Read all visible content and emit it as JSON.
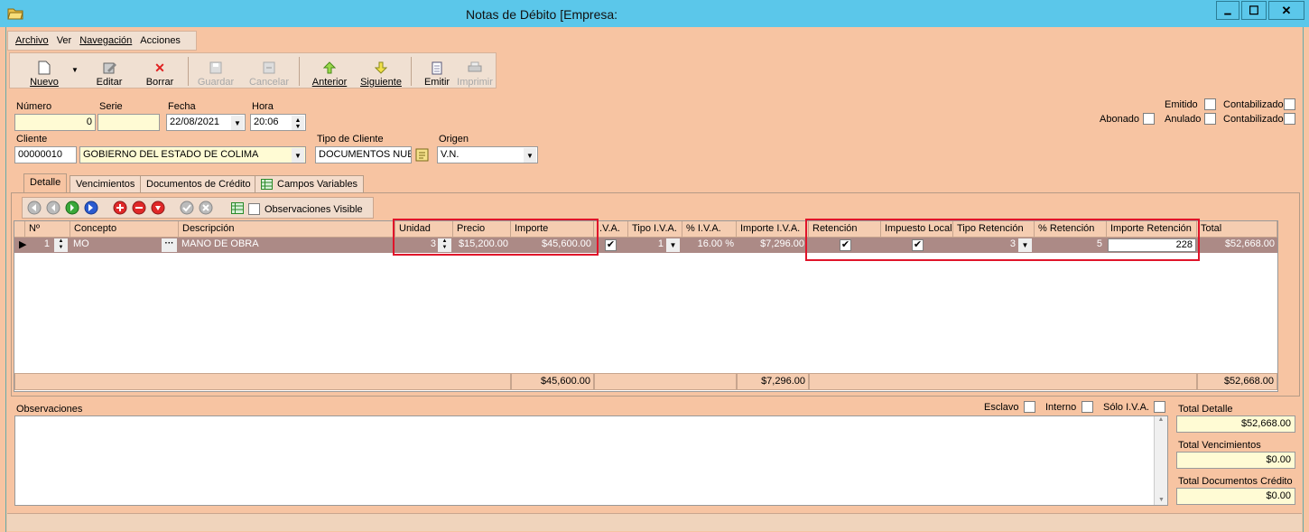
{
  "window": {
    "title": "Notas de Débito [Empresa:",
    "minimize": "▁",
    "maximize": "☐",
    "close": "✕"
  },
  "menu": [
    "Archivo",
    "Ver",
    "Navegación",
    "Acciones"
  ],
  "toolbar": {
    "nuevo": "Nuevo",
    "editar": "Editar",
    "borrar": "Borrar",
    "guardar": "Guardar",
    "cancelar": "Cancelar",
    "anterior": "Anterior",
    "siguiente": "Siguiente",
    "emitir": "Emitir",
    "imprimir": "Imprimir"
  },
  "header": {
    "numero_label": "Número",
    "numero": "0",
    "serie_label": "Serie",
    "serie": "",
    "fecha_label": "Fecha",
    "fecha": "22/08/2021",
    "hora_label": "Hora",
    "hora": "20:06",
    "cliente_label": "Cliente",
    "cliente_codigo": "00000010",
    "cliente_nombre": "GOBIERNO DEL ESTADO DE COLIMA",
    "tipo_cliente_label": "Tipo de Cliente",
    "tipo_cliente": "DOCUMENTOS NUEV",
    "origen_label": "Origen",
    "origen": "V.N."
  },
  "flags": {
    "emitido": "Emitido",
    "contabilizado1": "Contabilizado",
    "abonado": "Abonado",
    "anulado": "Anulado",
    "contabilizado2": "Contabilizado"
  },
  "tabs": [
    "Detalle",
    "Vencimientos",
    "Documentos de Crédito",
    "Campos Variables"
  ],
  "observaciones_visible": "Observaciones Visible",
  "grid": {
    "columns": [
      "Nº",
      "Concepto",
      "Descripción",
      "Unidad",
      "Precio",
      "Importe",
      "I.V.A.",
      "Tipo I.V.A.",
      "% I.V.A.",
      "Importe I.V.A.",
      "Retención",
      "Impuesto Local",
      "Tipo Retención",
      "% Retención",
      "Importe Retención",
      "Total"
    ],
    "row": {
      "num": "1",
      "concepto": "MO",
      "descripcion": "MANO DE OBRA",
      "unidad": "3",
      "precio": "$15,200.00",
      "importe": "$45,600.00",
      "tipo_iva": "1",
      "pct_iva": "16.00 %",
      "importe_iva": "$7,296.00",
      "tipo_retencion": "3",
      "pct_retencion": "5",
      "importe_retencion": "228",
      "total": "$52,668.00"
    },
    "footer": {
      "importe": "$45,600.00",
      "importe_iva": "$7,296.00",
      "total": "$52,668.00"
    }
  },
  "bottom": {
    "observaciones_label": "Observaciones",
    "esclavo": "Esclavo",
    "interno": "Interno",
    "solo_iva": "Sólo I.V.A.",
    "total_detalle_label": "Total Detalle",
    "total_detalle": "$52,668.00",
    "total_vencimientos_label": "Total Vencimientos",
    "total_vencimientos": "$0.00",
    "total_documentos_label": "Total Documentos Crédito",
    "total_documentos": "$0.00"
  }
}
